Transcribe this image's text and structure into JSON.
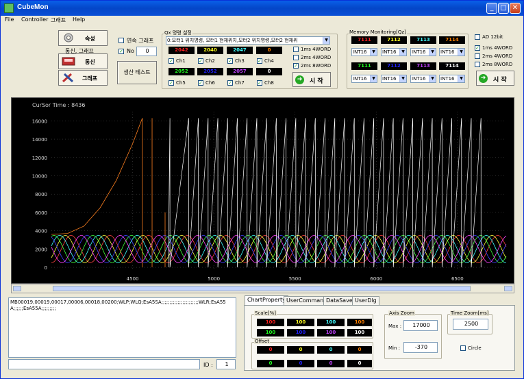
{
  "window": {
    "title": "CubeMon"
  },
  "menu": [
    "File",
    "Controller",
    "그래프",
    "Help"
  ],
  "left_buttons": {
    "props_label": "속성",
    "group_caption": "통신, 그래프",
    "comm_label": "통신",
    "graph_label": "그래프"
  },
  "continuous": {
    "label": "연속 그래프",
    "checked": false,
    "no_label": "No",
    "no_checked": true,
    "no_value": "0",
    "prod_test": "생산 테스트"
  },
  "qx": {
    "title": "Qx 명령 설정",
    "select": "0:모터1 위치명령, 모터1 현재위치,모터2 위치명령,모터2 현재위",
    "row1": [
      {
        "value": "2042",
        "color": "#ff2020"
      },
      {
        "value": "2040",
        "color": "#ffff20"
      },
      {
        "value": "2047",
        "color": "#40ffff"
      },
      {
        "value": "0",
        "color": "#ff8000"
      }
    ],
    "row1_checks": [
      "Ch1",
      "Ch2",
      "Ch3",
      "Ch4"
    ],
    "row2": [
      {
        "value": "2052",
        "color": "#20ff20"
      },
      {
        "value": "2052",
        "color": "#2020ff"
      },
      {
        "value": "2057",
        "color": "#c040ff"
      },
      {
        "value": "0",
        "color": "#ffffff"
      }
    ],
    "row2_checks": [
      "Ch5",
      "Ch6",
      "Ch7",
      "Ch8"
    ],
    "modes": [
      {
        "label": "1ms 4WORD",
        "checked": false
      },
      {
        "label": "2ms 4WORD",
        "checked": false
      },
      {
        "label": "2ms 8WORD",
        "checked": true
      }
    ],
    "start": "시 작"
  },
  "mem": {
    "title": "Memory Monitoring[Qz]",
    "row1": [
      {
        "value": "7111",
        "color": "#ff2020"
      },
      {
        "value": "7112",
        "color": "#ffff20"
      },
      {
        "value": "7113",
        "color": "#40ffff"
      },
      {
        "value": "7114",
        "color": "#ff8000"
      }
    ],
    "row2": [
      {
        "value": "7111",
        "color": "#20ff20"
      },
      {
        "value": "7112",
        "color": "#2020ff"
      },
      {
        "value": "7113",
        "color": "#c040ff"
      },
      {
        "value": "7114",
        "color": "#ffffff"
      }
    ],
    "type": "INT16",
    "modes": [
      {
        "label": "AD 12bit",
        "checked": false
      },
      {
        "label": "1ms 4WORD",
        "checked": true
      },
      {
        "label": "2ms 4WORD",
        "checked": false
      },
      {
        "label": "2ms 8WORD",
        "checked": false
      }
    ],
    "start": "시 작"
  },
  "chart_data": {
    "type": "line",
    "cursor_label": "CurSor Time : 8436",
    "xlim": [
      4000,
      6800
    ],
    "ylim": [
      -370,
      17000
    ],
    "x_ticks": [
      "4500",
      "5000",
      "5500",
      "6000",
      "6500"
    ],
    "y_ticks": [
      "16000",
      "14000",
      "12000",
      "10000",
      "8000",
      "6000",
      "4000",
      "2000",
      "0"
    ],
    "sawtooth_peaks_x": [
      4730,
      4845,
      4905,
      4965,
      5025,
      5085,
      5145,
      5205,
      5265,
      5325,
      5385,
      5445,
      5505,
      5565,
      5625,
      5685,
      5745,
      5805,
      5865,
      5925,
      5985,
      6045,
      6105,
      6165,
      6225,
      6285,
      6345,
      6405,
      6465,
      6525,
      6585,
      6645
    ],
    "orange_curve": [
      [
        4000,
        3600
      ],
      [
        4100,
        3700
      ],
      [
        4200,
        4500
      ],
      [
        4300,
        6500
      ],
      [
        4400,
        9500
      ],
      [
        4500,
        13500
      ],
      [
        4560,
        16300
      ]
    ],
    "grid": true
  },
  "console": {
    "text": "MB00019,00019,00017,00006,00018,00200;WLP;WLQ;EsA5SA;;;;;;;;;;;;;;;;;;;;;;;WLR;EsA55A;;;;;;EsA55A;;;;;;;;;",
    "id_label": "ID :",
    "id_value": "1"
  },
  "tabs": [
    "ChartProperty",
    "UserCommand",
    "DataSave",
    "UserDlg"
  ],
  "chart_prop": {
    "scale_label": "Scale[%]",
    "scale_row1": [
      {
        "value": "100",
        "color": "#ff2020"
      },
      {
        "value": "100",
        "color": "#ffff20"
      },
      {
        "value": "100",
        "color": "#40ffff"
      },
      {
        "value": "100",
        "color": "#ff8000"
      }
    ],
    "scale_row2": [
      {
        "value": "100",
        "color": "#20ff20"
      },
      {
        "value": "100",
        "color": "#2020ff"
      },
      {
        "value": "100",
        "color": "#c040ff"
      },
      {
        "value": "100",
        "color": "#ffffff"
      }
    ],
    "offset_label": "Offset",
    "offset_row1": [
      {
        "value": "0",
        "color": "#ff2020"
      },
      {
        "value": "0",
        "color": "#ffff20"
      },
      {
        "value": "0",
        "color": "#40ffff"
      },
      {
        "value": "0",
        "color": "#ff8000"
      }
    ],
    "offset_row2": [
      {
        "value": "0",
        "color": "#20ff20"
      },
      {
        "value": "0",
        "color": "#2020ff"
      },
      {
        "value": "0",
        "color": "#c040ff"
      },
      {
        "value": "0",
        "color": "#ffffff"
      }
    ],
    "axis_zoom_label": "Axis Zoom",
    "max_label": "Max :",
    "max_value": "17000",
    "min_label": "Min :",
    "min_value": "-370",
    "time_zoom_label": "Time Zoom[ms]",
    "time_zoom_value": "2500",
    "circle_label": "Circle",
    "circle_checked": false
  }
}
